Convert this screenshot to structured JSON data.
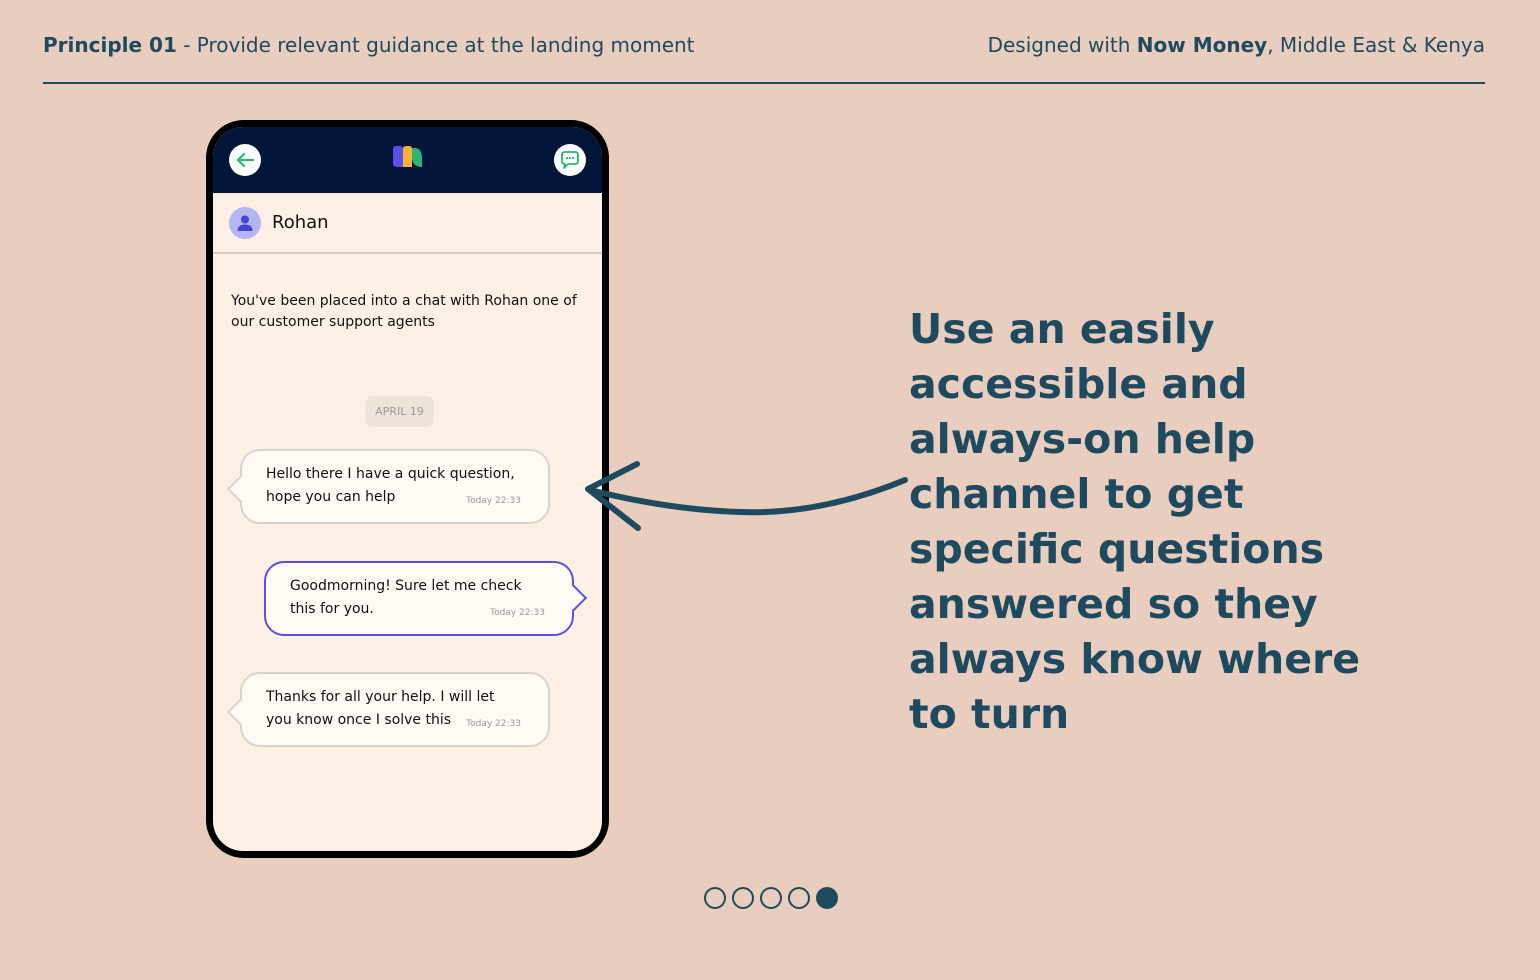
{
  "header": {
    "principle_bold": "Principle 01",
    "principle_text": " - Provide relevant guidance at the landing moment",
    "designed_prefix": "Designed with ",
    "designed_bold": "Now Money",
    "designed_suffix": ", Middle East & Kenya"
  },
  "phone": {
    "agent_name": "Rohan",
    "intro": "You've been placed into a chat with Rohan one of our customer support agents",
    "date_label": "APRIL 19",
    "messages": [
      {
        "direction": "incoming",
        "text": "Hello there I have a quick question, hope you can help",
        "time": "Today 22:33"
      },
      {
        "direction": "outgoing",
        "text": "Goodmorning! Sure let me check this for you.",
        "time": "Today 22:33"
      },
      {
        "direction": "incoming",
        "text": "Thanks for all your help. I will let you know once I solve this",
        "time": "Today 22:33"
      }
    ],
    "icons": {
      "back": "arrow-left-icon",
      "chat": "chat-bubble-icon",
      "logo": "now-money-logo",
      "avatar": "user-icon"
    },
    "colors": {
      "topbar": "#011638",
      "accent_green": "#2bb673",
      "bubble_outgoing_border": "#5b4fe6"
    }
  },
  "tagline": "Use an easily accessible and always-on help channel to get specific questions answered so they always know where to turn",
  "pagination": {
    "total": 5,
    "active_index": 4
  },
  "colors": {
    "background": "#e9cdbf",
    "text": "#1d4a5e"
  }
}
